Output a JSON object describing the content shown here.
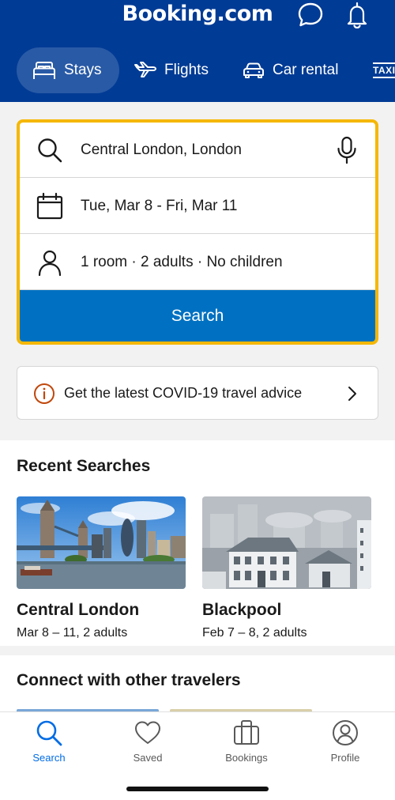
{
  "header": {
    "brand": "Booking.com",
    "icons": {
      "chat": "chat-bubble-icon",
      "bell": "bell-icon"
    },
    "background_color": "#003b95"
  },
  "nav": {
    "items": [
      {
        "label": "Stays",
        "icon": "bed-icon",
        "active": true
      },
      {
        "label": "Flights",
        "icon": "plane-icon",
        "active": false
      },
      {
        "label": "Car rental",
        "icon": "car-icon",
        "active": false
      },
      {
        "label": "TAXI",
        "icon": "taxi-icon",
        "active": false
      }
    ]
  },
  "search": {
    "destination": "Central London, London",
    "dates": "Tue, Mar 8 - Fri, Mar 11",
    "guests": "1 room · 2 adults · No children",
    "button_label": "Search",
    "border_color": "#f5b700",
    "button_color": "#0071c2"
  },
  "covid": {
    "text": "Get the latest COVID-19 travel advice"
  },
  "recent": {
    "title": "Recent Searches",
    "items": [
      {
        "name": "Central London",
        "meta": "Mar 8 – 11, 2 adults",
        "image": "london-skyline-photo"
      },
      {
        "name": "Blackpool",
        "meta": "Feb 7 – 8, 2 adults",
        "image": "town-illustration"
      }
    ]
  },
  "connect": {
    "title": "Connect with other travelers"
  },
  "tabbar": {
    "items": [
      {
        "label": "Search",
        "icon": "search-icon",
        "active": true
      },
      {
        "label": "Saved",
        "icon": "heart-icon",
        "active": false
      },
      {
        "label": "Bookings",
        "icon": "suitcase-icon",
        "active": false
      },
      {
        "label": "Profile",
        "icon": "profile-icon",
        "active": false
      }
    ],
    "active_color": "#006ce4"
  }
}
